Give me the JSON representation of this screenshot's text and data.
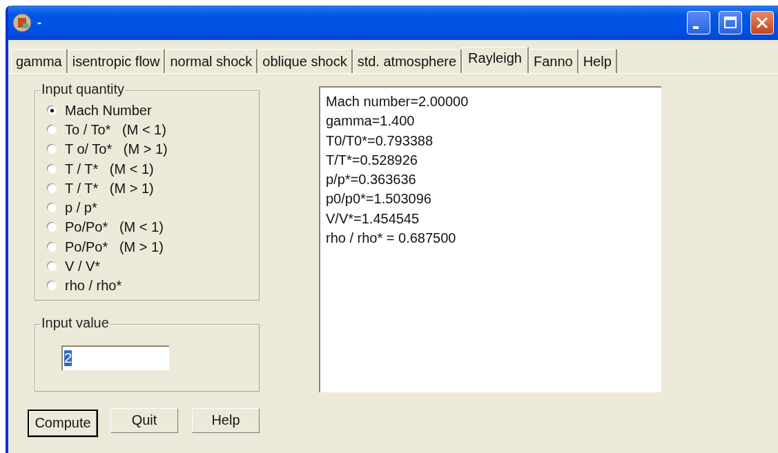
{
  "window": {
    "title": "-"
  },
  "tabs": [
    {
      "label": "gamma",
      "selected": false
    },
    {
      "label": "isentropic flow",
      "selected": false
    },
    {
      "label": "normal shock",
      "selected": false
    },
    {
      "label": "oblique shock",
      "selected": false
    },
    {
      "label": "std. atmosphere",
      "selected": false
    },
    {
      "label": "Rayleigh",
      "selected": true
    },
    {
      "label": "Fanno",
      "selected": false
    },
    {
      "label": "Help",
      "selected": false
    }
  ],
  "input_quantity": {
    "label": "Input quantity",
    "options": [
      {
        "label": "Mach Number",
        "selected": true
      },
      {
        "label": "To / To*   (M < 1)",
        "selected": false
      },
      {
        "label": "T o/ To*   (M > 1)",
        "selected": false
      },
      {
        "label": "T / T*   (M < 1)",
        "selected": false
      },
      {
        "label": "T / T*   (M > 1)",
        "selected": false
      },
      {
        "label": "p / p*",
        "selected": false
      },
      {
        "label": "Po/Po*   (M < 1)",
        "selected": false
      },
      {
        "label": "Po/Po*   (M > 1)",
        "selected": false
      },
      {
        "label": "V / V*",
        "selected": false
      },
      {
        "label": "rho / rho*",
        "selected": false
      }
    ]
  },
  "input_value": {
    "label": "Input value",
    "value": "2",
    "selected": true
  },
  "output": [
    "Mach number=2.00000",
    "gamma=1.400",
    "T0/T0*=0.793388",
    "T/T*=0.528926",
    "p/p*=0.363636",
    "p0/p0*=1.503096",
    "V/V*=1.454545",
    "rho / rho* = 0.687500"
  ],
  "buttons": [
    {
      "label": "Compute",
      "default": true
    },
    {
      "label": "Quit",
      "default": false
    },
    {
      "label": "Help",
      "default": false
    }
  ]
}
